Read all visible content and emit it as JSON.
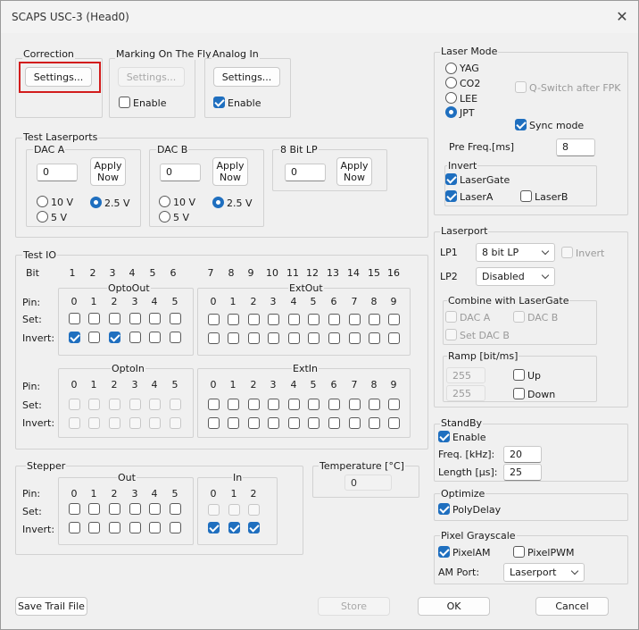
{
  "window": {
    "title": "SCAPS USC-3 (Head0)"
  },
  "correction": {
    "title": "Correction",
    "settings_label": "Settings..."
  },
  "marking": {
    "title": "Marking On The Fly",
    "settings_label": "Settings...",
    "enable_label": "Enable",
    "enable_checked": false
  },
  "analog": {
    "title": "Analog In",
    "settings_label": "Settings...",
    "enable_label": "Enable",
    "enable_checked": true
  },
  "test_laserports": {
    "title": "Test Laserports",
    "daca": {
      "title": "DAC A",
      "value": "0",
      "apply": "Apply Now",
      "r10": "10 V",
      "r25": "2.5 V",
      "r5": "5 V"
    },
    "dacb": {
      "title": "DAC B",
      "value": "0",
      "apply": "Apply Now",
      "r10": "10 V",
      "r25": "2.5 V",
      "r5": "5 V"
    },
    "lp8": {
      "title": "8 Bit LP",
      "value": "0",
      "apply": "Apply Now"
    }
  },
  "test_io": {
    "title": "Test IO",
    "bit_label": "Bit",
    "bits": [
      "1",
      "2",
      "3",
      "4",
      "5",
      "6",
      "7",
      "8",
      "9",
      "10",
      "11",
      "12",
      "13",
      "14",
      "15",
      "16"
    ],
    "pin_label": "Pin:",
    "set_label": "Set:",
    "invert_label": "Invert:",
    "optoout": "OptoOut",
    "extout": "ExtOut",
    "optoin": "OptoIn",
    "extin": "ExtIn",
    "pins6": [
      "0",
      "1",
      "2",
      "3",
      "4",
      "5"
    ],
    "pins10": [
      "0",
      "1",
      "2",
      "3",
      "4",
      "5",
      "6",
      "7",
      "8",
      "9"
    ],
    "optoout_invert": [
      true,
      false,
      true,
      false,
      false,
      false
    ]
  },
  "stepper": {
    "title": "Stepper",
    "out": "Out",
    "in": "In",
    "pin_label": "Pin:",
    "set_label": "Set:",
    "invert_label": "Invert:",
    "pins_out": [
      "0",
      "1",
      "2",
      "3",
      "4",
      "5"
    ],
    "pins_in": [
      "0",
      "1",
      "2"
    ]
  },
  "temperature": {
    "title": "Temperature [°C]",
    "value": "0"
  },
  "laser_mode": {
    "title": "Laser Mode",
    "yag": "YAG",
    "co2": "CO2",
    "lee": "LEE",
    "jpt": "JPT",
    "selected": "JPT",
    "qswitch": "Q-Switch after FPK",
    "sync": "Sync mode",
    "sync_checked": true,
    "prefreq_label": "Pre Freq.[ms]",
    "prefreq_value": "8",
    "invert_title": "Invert",
    "lasergate": "LaserGate",
    "lasera": "LaserA",
    "laserb": "LaserB"
  },
  "laserport": {
    "title": "Laserport",
    "lp1_label": "LP1",
    "lp1_value": "8 bit LP",
    "invert": "Invert",
    "lp2_label": "LP2",
    "lp2_value": "Disabled",
    "combine_title": "Combine with LaserGate",
    "daca": "DAC A",
    "dacb": "DAC B",
    "setdacb": "Set DAC B",
    "ramp_title": "Ramp [bit/ms]",
    "ramp_up_value": "255",
    "ramp_down_value": "255",
    "up": "Up",
    "down": "Down"
  },
  "standby": {
    "title": "StandBy",
    "enable": "Enable",
    "freq_label": "Freq. [kHz]:",
    "freq_value": "20",
    "length_label": "Length [µs]:",
    "length_value": "25"
  },
  "optimize": {
    "title": "Optimize",
    "polydelay": "PolyDelay"
  },
  "pixel": {
    "title": "Pixel Grayscale",
    "pixelam": "PixelAM",
    "pixelpwm": "PixelPWM",
    "amport_label": "AM Port:",
    "amport_value": "Laserport"
  },
  "footer": {
    "save_trail": "Save Trail File",
    "store": "Store",
    "ok": "OK",
    "cancel": "Cancel"
  }
}
